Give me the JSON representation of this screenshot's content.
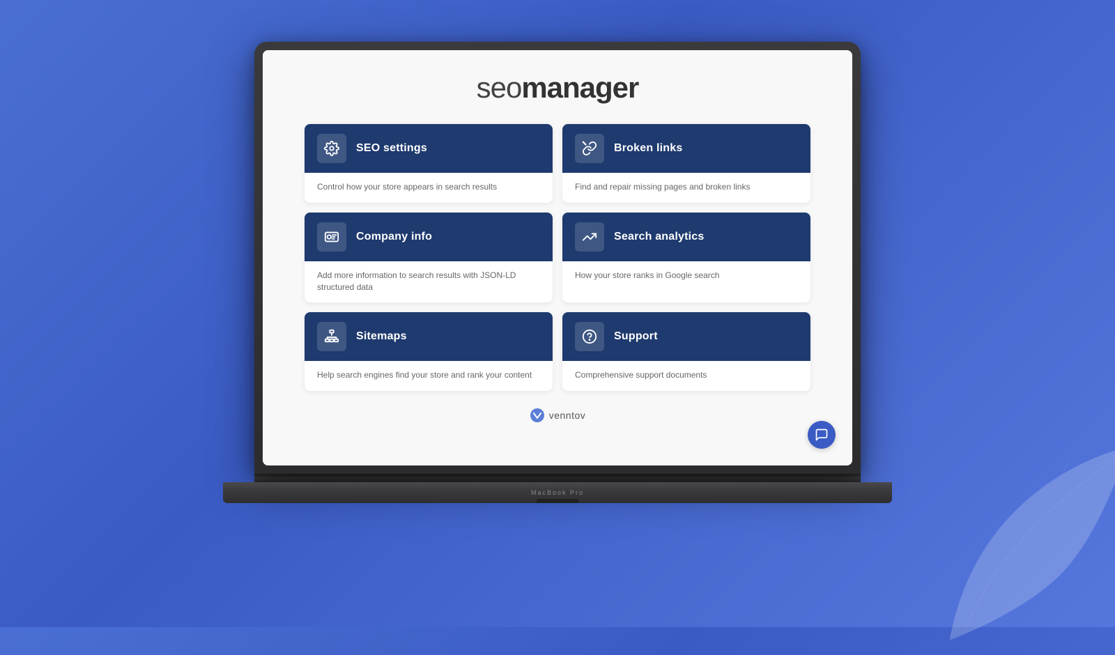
{
  "background": {
    "gradient_start": "#4a6fd4",
    "gradient_end": "#3a5bc4"
  },
  "laptop": {
    "model_label": "MacBook Pro"
  },
  "app": {
    "logo": {
      "seo": "seo",
      "manager": "manager",
      "full": "seomanager"
    },
    "cards": [
      {
        "id": "seo-settings",
        "title": "SEO settings",
        "description": "Control how your store appears in search results",
        "icon": "gear"
      },
      {
        "id": "broken-links",
        "title": "Broken links",
        "description": "Find and repair missing pages and broken links",
        "icon": "broken-link"
      },
      {
        "id": "company-info",
        "title": "Company info",
        "description": "Add more information to search results with JSON-LD structured data",
        "icon": "id-card"
      },
      {
        "id": "search-analytics",
        "title": "Search analytics",
        "description": "How your store ranks in Google search",
        "icon": "chart"
      },
      {
        "id": "sitemaps",
        "title": "Sitemaps",
        "description": "Help search engines find your store and rank your content",
        "icon": "sitemap"
      },
      {
        "id": "support",
        "title": "Support",
        "description": "Comprehensive support documents",
        "icon": "support"
      }
    ],
    "brand": {
      "name": "venntov",
      "accent_color": "#4a6fd4"
    },
    "chat_button": {
      "label": "Chat support"
    }
  }
}
